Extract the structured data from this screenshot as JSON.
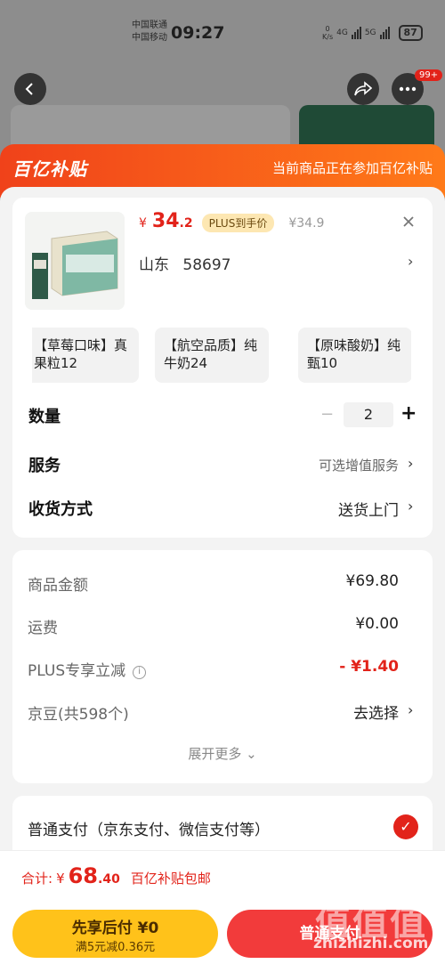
{
  "status_bar": {
    "carrier1": "中国联通",
    "carrier2": "中国移动",
    "time": "09:27",
    "net_speed_value": "0",
    "net_speed_unit": "K/s",
    "net1": "4G",
    "net2": "5G",
    "battery": "87"
  },
  "nav": {
    "back_icon": "chevron-left-icon",
    "share_icon": "share-icon",
    "more_icon": "more-icon",
    "badge": "99+"
  },
  "promo": {
    "logo": "百亿补贴",
    "text": "当前商品正在参加百亿补贴"
  },
  "product": {
    "price_currency": "¥",
    "price_int": "34",
    "price_dec": ".2",
    "plus_tag": "PLUS到手价",
    "orig_price": "¥34.9",
    "address_region": "山东",
    "address_code": "58697"
  },
  "variants": [
    {
      "label": "【草莓口味】真果粒12"
    },
    {
      "label": "【航空品质】纯牛奶24"
    },
    {
      "label": "【原味酸奶】纯甄10"
    }
  ],
  "quantity": {
    "label": "数量",
    "value": "2",
    "minus": "−",
    "plus": "+"
  },
  "service": {
    "label": "服务",
    "value": "可选增值服务"
  },
  "delivery": {
    "label": "收货方式",
    "value": "送货上门"
  },
  "fees": {
    "goods_label": "商品金额",
    "goods_value": "¥69.80",
    "freight_label": "运费",
    "freight_value": "¥0.00",
    "plus_label": "PLUS专享立减",
    "plus_value": "- ¥1.40",
    "jd_bean_label": "京豆(共598个)",
    "jd_bean_value": "去选择",
    "expand": "展开更多"
  },
  "payment": {
    "label": "普通支付（京东支付、微信支付等）"
  },
  "bottom": {
    "total_label": "合计:",
    "total_currency": "¥",
    "total_int": "68",
    "total_dec": ".40",
    "total_note": "百亿补贴包邮",
    "later_title": "先享后付 ¥0",
    "later_sub": "满5元减0.36元",
    "pay_button": "普通支付",
    "watermark": "值值值",
    "watermark_url": "zhizhizhi.com"
  },
  "colors": {
    "accent": "#e2231a",
    "promo": "#f0421a",
    "later": "#ffc21a"
  }
}
